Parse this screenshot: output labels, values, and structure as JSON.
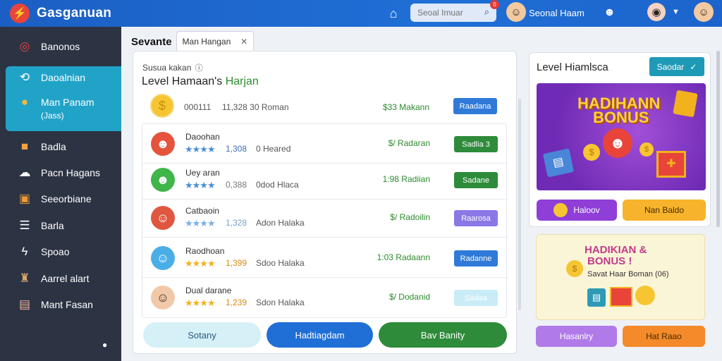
{
  "app": {
    "title": "Gasganuan"
  },
  "header": {
    "search_placeholder": "Seoal Imuar",
    "notification_count": "0",
    "user_name": "Seonal Haam"
  },
  "sidebar": {
    "items": [
      {
        "label": "Banonos",
        "icon": "target-icon"
      },
      {
        "label": "Daoalnian",
        "icon": "refresh-icon"
      },
      {
        "label": "Man Panam",
        "sublabel": "(Jass)",
        "icon": "coin-icon"
      },
      {
        "label": "Badla",
        "icon": "gift-icon"
      },
      {
        "label": "Pacn Hagans",
        "icon": "chat-icon"
      },
      {
        "label": "Seeorbiane",
        "icon": "box-icon"
      },
      {
        "label": "Barla",
        "icon": "list-icon"
      },
      {
        "label": "Spoao",
        "icon": "lightning-icon"
      },
      {
        "label": "Aarrel alart",
        "icon": "bell-icon"
      },
      {
        "label": "Mant Fasan",
        "icon": "card-icon"
      }
    ]
  },
  "main": {
    "page_title": "Sevante",
    "tab_label": "Man Hangan",
    "sub_label": "Susua kakan",
    "level_title": "Level Hamaan's",
    "level_highlight": "Harjan",
    "summary": {
      "id": "000111",
      "value": "11,328 30 Roman",
      "amount": "$33 Makann",
      "button": "Raadana"
    },
    "rows": [
      {
        "name": "Daoohan",
        "stars": "★★★★",
        "score": "1,308",
        "meta": "0 Heared",
        "amount": "$/ Radaran",
        "button": "Sadlia 3"
      },
      {
        "name": "Uey aran",
        "stars": "★★★★",
        "score": "0,388",
        "meta": "0dod Hlaca",
        "amount": "1:98 Radiian",
        "button": "Sadane"
      },
      {
        "name": "Catbaoin",
        "stars": "★★★★",
        "score": "1,328",
        "meta": "Adon Halaka",
        "amount": "$/ Radoilin",
        "button": "Raarosa"
      },
      {
        "name": "Raodhoan",
        "stars": "★★★★",
        "score": "1,399",
        "meta": "Sdoo Halaka",
        "amount": "1:03 Radaann",
        "button": "Radanne"
      },
      {
        "name": "Dual darane",
        "stars": "★★★★",
        "score": "1,239",
        "meta": "Sdon Halaka",
        "amount": "$/ Dodanid",
        "button": "Sadaa"
      }
    ],
    "bottom_buttons": [
      "Sotany",
      "Hadtiagdam",
      "Bav Banity"
    ]
  },
  "right": {
    "title": "Level Hiamlsca",
    "button": "Saodar",
    "banner1": {
      "line1": "HADIHANN",
      "line2": "BONUS"
    },
    "pills1": [
      "Haloov",
      "Nan Baldo"
    ],
    "banner2": {
      "line1": "HADIKIAN &",
      "line2": "BONUS !",
      "sub": "Savat Haar Boman (06)"
    },
    "pills2": [
      "Hasanlry",
      "Hat Raao"
    ]
  },
  "colors": {
    "topbar": "#1f6fd6",
    "sidebar": "#2c3444",
    "sidebar_active": "#21a3c8",
    "blue_btn": "#2f7ad8",
    "green_btn": "#2e8b3a",
    "purple_btn": "#8b78e6"
  }
}
